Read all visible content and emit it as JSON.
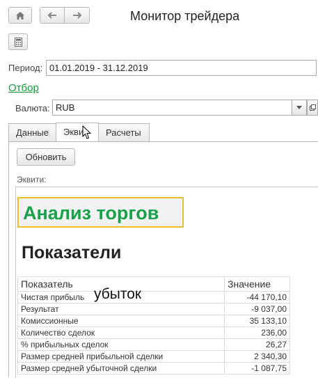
{
  "window": {
    "title": "Монитор трейдера"
  },
  "period": {
    "label": "Период:",
    "value": "01.01.2019 - 31.12.2019"
  },
  "filter_link": "Отбор",
  "currency": {
    "label": "Валюта:",
    "value": "RUB"
  },
  "tabs": [
    {
      "label": "Данные",
      "active": false
    },
    {
      "label": "Экви",
      "active": true
    },
    {
      "label": "Расчеты",
      "active": false
    }
  ],
  "refresh_button": "Обновить",
  "equity_label": "Эквити:",
  "report": {
    "heading": "Анализ торгов",
    "subheading": "Показатели",
    "overlay_text": "убыток",
    "columns": [
      "Показатель",
      "Значение"
    ],
    "rows": [
      [
        "Чистая прибыль",
        "-44 170,10"
      ],
      [
        "Результат",
        "-9 037,00"
      ],
      [
        "Комиссионные",
        "35 133,10"
      ],
      [
        "Количество сделок",
        "236,00"
      ],
      [
        "% прибыльных сделок",
        "26,27"
      ],
      [
        "Размер средней прибыльной сделки",
        "2 340,30"
      ],
      [
        "Размер средней убыточной сделки",
        "-1 087,75"
      ]
    ]
  },
  "colors": {
    "link_green": "#1a9a3a",
    "heading_green": "#1aa04b",
    "heading_border": "#e8c020"
  }
}
